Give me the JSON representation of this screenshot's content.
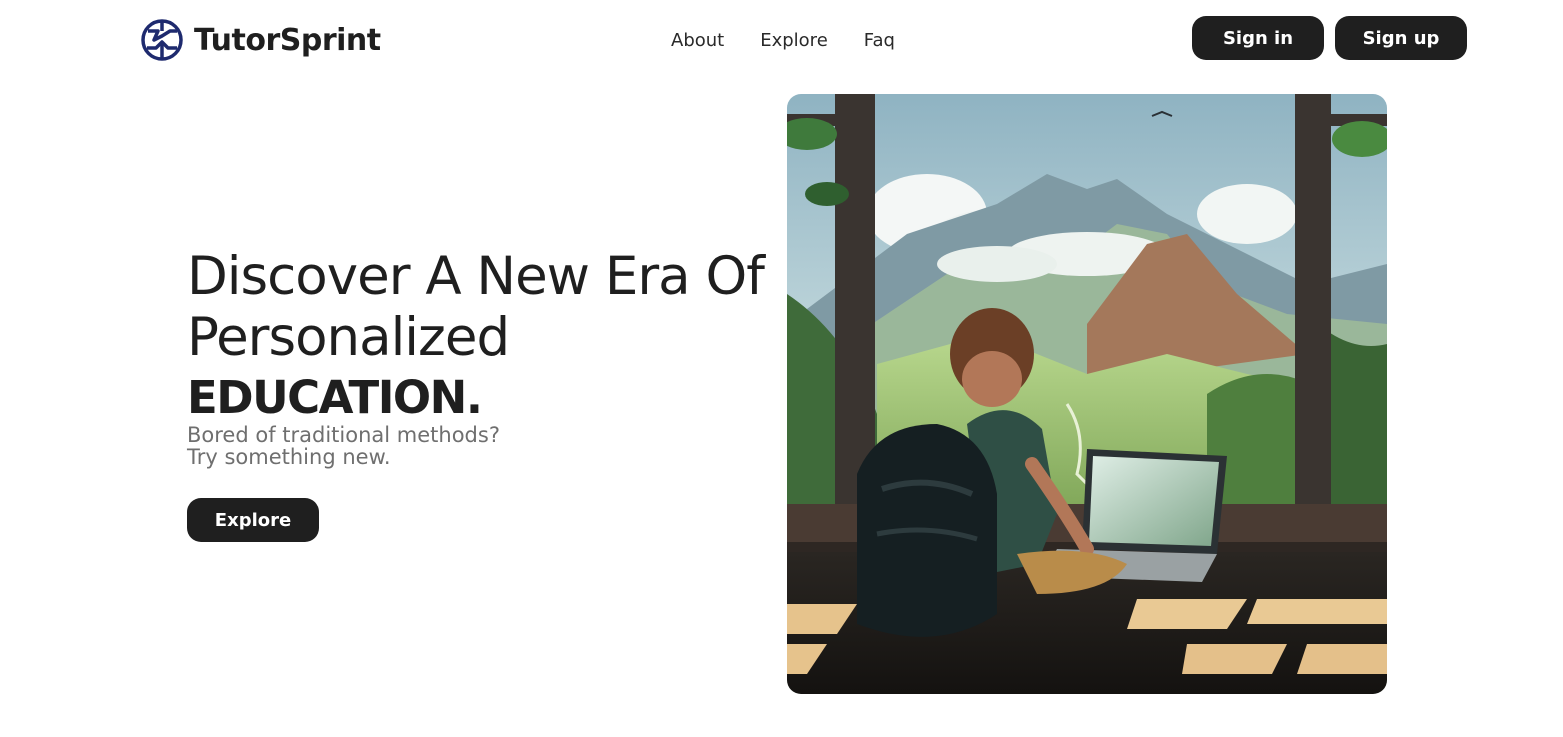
{
  "brand": {
    "name": "TutorSprint",
    "logo_icon": "tutorsprint-logo-icon",
    "logo_color": "#1e2a6e"
  },
  "nav": {
    "items": [
      {
        "label": "About"
      },
      {
        "label": "Explore"
      },
      {
        "label": "Faq"
      }
    ]
  },
  "auth": {
    "signin_label": "Sign in",
    "signup_label": "Sign up"
  },
  "hero": {
    "headline_line1": "Discover A New Era Of",
    "headline_line2": "Personalized",
    "headline_emphasis": "EDUCATION.",
    "subtitle_line1": "Bored of traditional methods?",
    "subtitle_line2": "Try something new.",
    "cta_label": "Explore",
    "image_icon": "boy-with-laptop-overlooking-mountains-illustration"
  },
  "colors": {
    "text_dark": "#1f1f1f",
    "text_muted": "#6f6f6f",
    "button_bg": "#1f1f1f",
    "button_text": "#ffffff",
    "background": "#ffffff"
  }
}
